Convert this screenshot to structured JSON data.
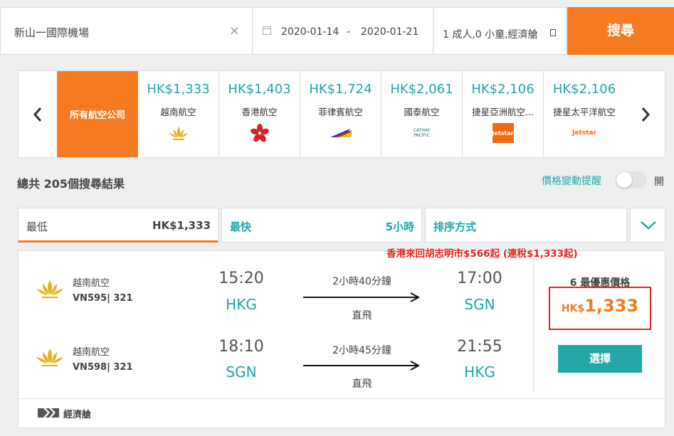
{
  "search": {
    "destination": "新山一國際機場",
    "clear_icon": "close-icon",
    "depart_date": "2020-01-14",
    "date_separator": "-",
    "return_date": "2020-01-21",
    "passengers": "1 成人,0 小童,經濟艙",
    "search_label": "搜尋"
  },
  "carousel": {
    "all_label": "所有航空公司",
    "airlines": [
      {
        "price": "HK$1,333",
        "name": "越南航空",
        "logo": "lotus-logo"
      },
      {
        "price": "HK$1,403",
        "name": "香港航空",
        "logo": "bauhinia-logo"
      },
      {
        "price": "HK$1,724",
        "name": "菲律賓航空",
        "logo": "pal-logo"
      },
      {
        "price": "HK$2,061",
        "name": "國泰航空",
        "logo_text": "CATHAY PACIFIC"
      },
      {
        "price": "HK$2,106",
        "name": "捷星亞洲航空...",
        "logo_text": "Jetstar"
      },
      {
        "price": "HK$2,106",
        "name": "捷星太平洋航空",
        "logo_text": "Jetstar"
      }
    ]
  },
  "results": {
    "total": "總共 205個搜尋結果",
    "price_alert": "價格變動提醒",
    "toggle_label": "開"
  },
  "tabs": {
    "cheapest_label": "最低",
    "cheapest_value": "HK$1,333",
    "fastest_label": "最快",
    "fastest_value": "5小時",
    "sort_label": "排序方式"
  },
  "promo": "香港來回胡志明市$566起 (連稅$1,333起)",
  "itinerary": {
    "outbound": {
      "airline": "越南航空",
      "flight": "VN595| 321",
      "dep_time": "15:20",
      "dep_code": "HKG",
      "duration": "2小時40分鐘",
      "stops": "直飛",
      "arr_time": "17:00",
      "arr_code": "SGN"
    },
    "inbound": {
      "airline": "越南航空",
      "flight": "VN598| 321",
      "dep_time": "18:10",
      "dep_code": "SGN",
      "duration": "2小時45分鐘",
      "stops": "直飛",
      "arr_time": "21:55",
      "arr_code": "HKG"
    },
    "deal_label": "6 最優惠價格",
    "currency": "HK$",
    "price": "1,333",
    "select_label": "選擇",
    "cabin": "經濟艙"
  },
  "colors": {
    "accent_orange": "#f67a22",
    "teal": "#23a7a7",
    "promo_red": "#e8231e"
  }
}
